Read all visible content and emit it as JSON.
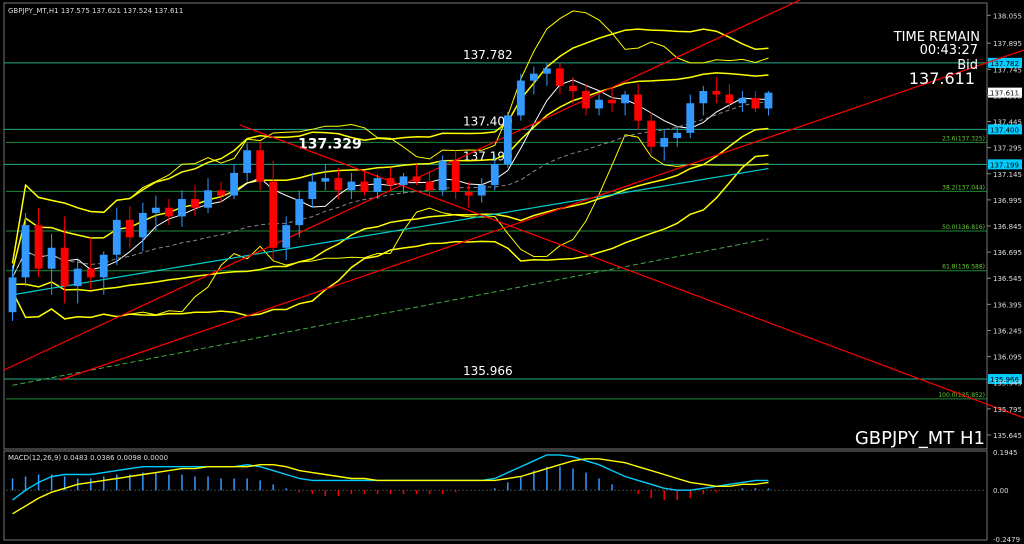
{
  "header": {
    "symbol_info": "GBPJPY_MT,H1  137.575 137.621 137.524 137.611",
    "time_remain_label": "TIME REMAIN",
    "time_remain_value": "00:43:27",
    "bid_label": "Bid",
    "bid_value": "137.611",
    "watermark": "GBPJPY_MT H1"
  },
  "colors": {
    "background": "#000000",
    "bull_candle": "#3399ff",
    "bear_candle": "#ff0000",
    "bollinger": "#ffff00",
    "ema_fast": "#ffffff",
    "ma_cyan": "#00cccc",
    "ma_green_dashed": "#44aa44",
    "trendline": "#ff0000",
    "level_line": "#22aa88",
    "fib_text": "#66cc33",
    "macd_line": "#00ccff",
    "signal_line": "#ffff00",
    "histogram_pos": "#3399ff",
    "histogram_neg": "#ff0000"
  },
  "chart_data": {
    "type": "candlestick",
    "price_axis": {
      "ylim": [
        135.57,
        138.12
      ],
      "ticks": [
        "138.055",
        "137.895",
        "137.745",
        "137.595",
        "137.445",
        "137.295",
        "137.145",
        "136.995",
        "136.845",
        "136.695",
        "136.545",
        "136.395",
        "136.245",
        "136.095",
        "135.945",
        "135.795",
        "135.645"
      ]
    },
    "levels": [
      {
        "price": 137.782,
        "label": "137.782",
        "axis_tag": "137.782"
      },
      {
        "price": 137.4,
        "label": "137.400",
        "axis_tag": "137.400"
      },
      {
        "price": 137.199,
        "label": "137.199",
        "axis_tag": "137.199"
      },
      {
        "price": 135.966,
        "label": "135.966",
        "axis_tag": "135.966"
      }
    ],
    "fib_levels": [
      {
        "price": 137.325,
        "label": "23.6(137.325)"
      },
      {
        "price": 137.044,
        "label": "38.2(137.044)"
      },
      {
        "price": 136.816,
        "label": "50.0(136.816)"
      },
      {
        "price": 136.588,
        "label": "61.8(136.588)"
      },
      {
        "price": 135.852,
        "label": "100.0(135.852)"
      }
    ],
    "annotations": [
      {
        "text": "137.329",
        "price": 137.329
      }
    ],
    "current_price": {
      "price": 137.611,
      "label": "137.611"
    },
    "candles": [
      [
        136.35,
        136.62,
        136.3,
        136.55
      ],
      [
        136.55,
        136.92,
        136.5,
        136.85
      ],
      [
        136.85,
        136.95,
        136.55,
        136.6
      ],
      [
        136.6,
        136.8,
        136.45,
        136.72
      ],
      [
        136.72,
        136.9,
        136.4,
        136.5
      ],
      [
        136.5,
        136.65,
        136.4,
        136.6
      ],
      [
        136.6,
        136.78,
        136.48,
        136.55
      ],
      [
        136.55,
        136.7,
        136.45,
        136.68
      ],
      [
        136.68,
        136.95,
        136.62,
        136.88
      ],
      [
        136.88,
        136.96,
        136.72,
        136.78
      ],
      [
        136.78,
        136.98,
        136.7,
        136.92
      ],
      [
        136.92,
        137.02,
        136.82,
        136.95
      ],
      [
        136.95,
        137.0,
        136.85,
        136.9
      ],
      [
        136.9,
        137.05,
        136.84,
        137.0
      ],
      [
        137.0,
        137.08,
        136.9,
        136.95
      ],
      [
        136.95,
        137.12,
        136.92,
        137.05
      ],
      [
        137.05,
        137.1,
        136.98,
        137.02
      ],
      [
        137.02,
        137.2,
        137.0,
        137.15
      ],
      [
        137.15,
        137.32,
        137.1,
        137.28
      ],
      [
        137.28,
        137.33,
        137.05,
        137.1
      ],
      [
        137.1,
        137.22,
        136.65,
        136.72
      ],
      [
        136.72,
        136.9,
        136.65,
        136.85
      ],
      [
        136.85,
        137.05,
        136.78,
        137.0
      ],
      [
        137.0,
        137.15,
        136.95,
        137.1
      ],
      [
        137.1,
        137.2,
        137.05,
        137.12
      ],
      [
        137.12,
        137.18,
        137.0,
        137.05
      ],
      [
        137.05,
        137.15,
        137.0,
        137.1
      ],
      [
        137.1,
        137.16,
        137.02,
        137.04
      ],
      [
        137.04,
        137.14,
        137.0,
        137.12
      ],
      [
        137.12,
        137.18,
        137.05,
        137.08
      ],
      [
        137.08,
        137.15,
        137.03,
        137.13
      ],
      [
        137.13,
        137.2,
        137.08,
        137.1
      ],
      [
        137.1,
        137.16,
        137.02,
        137.05
      ],
      [
        137.05,
        137.25,
        137.02,
        137.22
      ],
      [
        137.22,
        137.28,
        137.0,
        137.04
      ],
      [
        137.04,
        137.1,
        136.95,
        137.02
      ],
      [
        137.02,
        137.12,
        136.98,
        137.08
      ],
      [
        137.08,
        137.25,
        137.05,
        137.2
      ],
      [
        137.2,
        137.5,
        137.18,
        137.48
      ],
      [
        137.48,
        137.72,
        137.45,
        137.68
      ],
      [
        137.68,
        137.76,
        137.6,
        137.72
      ],
      [
        137.72,
        137.78,
        137.65,
        137.75
      ],
      [
        137.75,
        137.78,
        137.6,
        137.65
      ],
      [
        137.65,
        137.7,
        137.55,
        137.62
      ],
      [
        137.62,
        137.66,
        137.48,
        137.52
      ],
      [
        137.52,
        137.6,
        137.48,
        137.57
      ],
      [
        137.57,
        137.64,
        137.5,
        137.55
      ],
      [
        137.55,
        137.62,
        137.48,
        137.6
      ],
      [
        137.6,
        137.66,
        137.4,
        137.45
      ],
      [
        137.45,
        137.5,
        137.26,
        137.3
      ],
      [
        137.3,
        137.4,
        137.22,
        137.35
      ],
      [
        137.35,
        137.42,
        137.3,
        137.38
      ],
      [
        137.38,
        137.6,
        137.35,
        137.55
      ],
      [
        137.55,
        137.65,
        137.48,
        137.62
      ],
      [
        137.62,
        137.7,
        137.55,
        137.6
      ],
      [
        137.6,
        137.66,
        137.52,
        137.55
      ],
      [
        137.55,
        137.62,
        137.5,
        137.58
      ],
      [
        137.58,
        137.62,
        137.5,
        137.52
      ],
      [
        137.52,
        137.62,
        137.48,
        137.611
      ]
    ]
  },
  "macd": {
    "label": "MACD(12,26,9) 0.0483 0.0386 0.0098 0.0000",
    "ylim": [
      -0.2479,
      0.1945
    ],
    "ticks": [
      "0.1945",
      "0.00",
      "-0.2479"
    ],
    "hist": [
      0.06,
      0.07,
      0.08,
      0.08,
      0.07,
      0.06,
      0.06,
      0.07,
      0.08,
      0.08,
      0.09,
      0.09,
      0.08,
      0.08,
      0.07,
      0.07,
      0.06,
      0.06,
      0.06,
      0.05,
      0.03,
      0.01,
      -0.01,
      -0.02,
      -0.03,
      -0.03,
      -0.02,
      -0.02,
      -0.02,
      -0.02,
      -0.02,
      -0.02,
      -0.02,
      -0.02,
      -0.01,
      0.0,
      0.0,
      0.01,
      0.04,
      0.07,
      0.1,
      0.12,
      0.12,
      0.11,
      0.09,
      0.06,
      0.03,
      0.0,
      -0.02,
      -0.04,
      -0.05,
      -0.05,
      -0.04,
      -0.02,
      -0.01,
      0.0,
      0.01,
      0.01,
      0.01
    ],
    "macd_line": [
      -0.05,
      0.0,
      0.04,
      0.07,
      0.08,
      0.08,
      0.08,
      0.09,
      0.1,
      0.11,
      0.12,
      0.12,
      0.12,
      0.12,
      0.12,
      0.12,
      0.12,
      0.12,
      0.13,
      0.12,
      0.1,
      0.08,
      0.06,
      0.05,
      0.05,
      0.05,
      0.05,
      0.05,
      0.05,
      0.05,
      0.05,
      0.05,
      0.05,
      0.05,
      0.05,
      0.05,
      0.05,
      0.06,
      0.09,
      0.12,
      0.15,
      0.18,
      0.18,
      0.17,
      0.15,
      0.13,
      0.1,
      0.07,
      0.05,
      0.03,
      0.01,
      0.0,
      0.0,
      0.01,
      0.02,
      0.03,
      0.04,
      0.05,
      0.05
    ],
    "signal_line": [
      -0.12,
      -0.08,
      -0.04,
      -0.01,
      0.01,
      0.03,
      0.04,
      0.05,
      0.06,
      0.07,
      0.08,
      0.09,
      0.1,
      0.11,
      0.11,
      0.12,
      0.12,
      0.12,
      0.12,
      0.13,
      0.13,
      0.12,
      0.1,
      0.09,
      0.08,
      0.07,
      0.06,
      0.06,
      0.05,
      0.05,
      0.05,
      0.05,
      0.05,
      0.05,
      0.05,
      0.05,
      0.05,
      0.05,
      0.06,
      0.07,
      0.09,
      0.11,
      0.13,
      0.15,
      0.16,
      0.16,
      0.15,
      0.14,
      0.12,
      0.1,
      0.08,
      0.06,
      0.04,
      0.03,
      0.02,
      0.02,
      0.03,
      0.03,
      0.04
    ]
  }
}
